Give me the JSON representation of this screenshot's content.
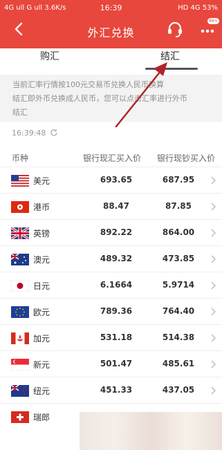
{
  "status_bar": {
    "left": "4G ull G ull 3.6K/s",
    "time": "16:39",
    "right": "HD 4G 53%"
  },
  "nav": {
    "title": "外汇兑换",
    "badge": "99+"
  },
  "tabs": {
    "buy": "购汇",
    "sell": "结汇"
  },
  "notice": {
    "line1": "当前汇率行情按100元交易币兑换人民币换算",
    "line2": "结汇即外币兑换成人民币，您可以点击汇率进行外币",
    "line3": "结汇"
  },
  "update_time": "16:39:48",
  "table": {
    "headers": [
      "币种",
      "银行现汇买入价",
      "银行现钞买入价"
    ],
    "rows": [
      {
        "name": "美元",
        "spot": "693.65",
        "cash": "687.95",
        "flag": "us-flag-icon"
      },
      {
        "name": "港币",
        "spot": "88.47",
        "cash": "87.85",
        "flag": "hk-flag-icon"
      },
      {
        "name": "英镑",
        "spot": "892.22",
        "cash": "864.00",
        "flag": "uk-flag-icon"
      },
      {
        "name": "澳元",
        "spot": "489.32",
        "cash": "473.85",
        "flag": "au-flag-icon"
      },
      {
        "name": "日元",
        "spot": "6.1664",
        "cash": "5.9714",
        "flag": "jp-flag-icon"
      },
      {
        "name": "欧元",
        "spot": "789.36",
        "cash": "764.40",
        "flag": "eu-flag-icon"
      },
      {
        "name": "加元",
        "spot": "531.18",
        "cash": "514.38",
        "flag": "ca-flag-icon"
      },
      {
        "name": "新元",
        "spot": "501.47",
        "cash": "485.61",
        "flag": "sg-flag-icon"
      },
      {
        "name": "纽元",
        "spot": "451.33",
        "cash": "437.05",
        "flag": "nz-flag-icon"
      },
      {
        "name": "瑞郎",
        "spot": "",
        "cash": "",
        "flag": "ch-flag-icon"
      }
    ]
  },
  "colors": {
    "header_red": "#e8473d",
    "annotation_arrow": "#b0242a"
  }
}
